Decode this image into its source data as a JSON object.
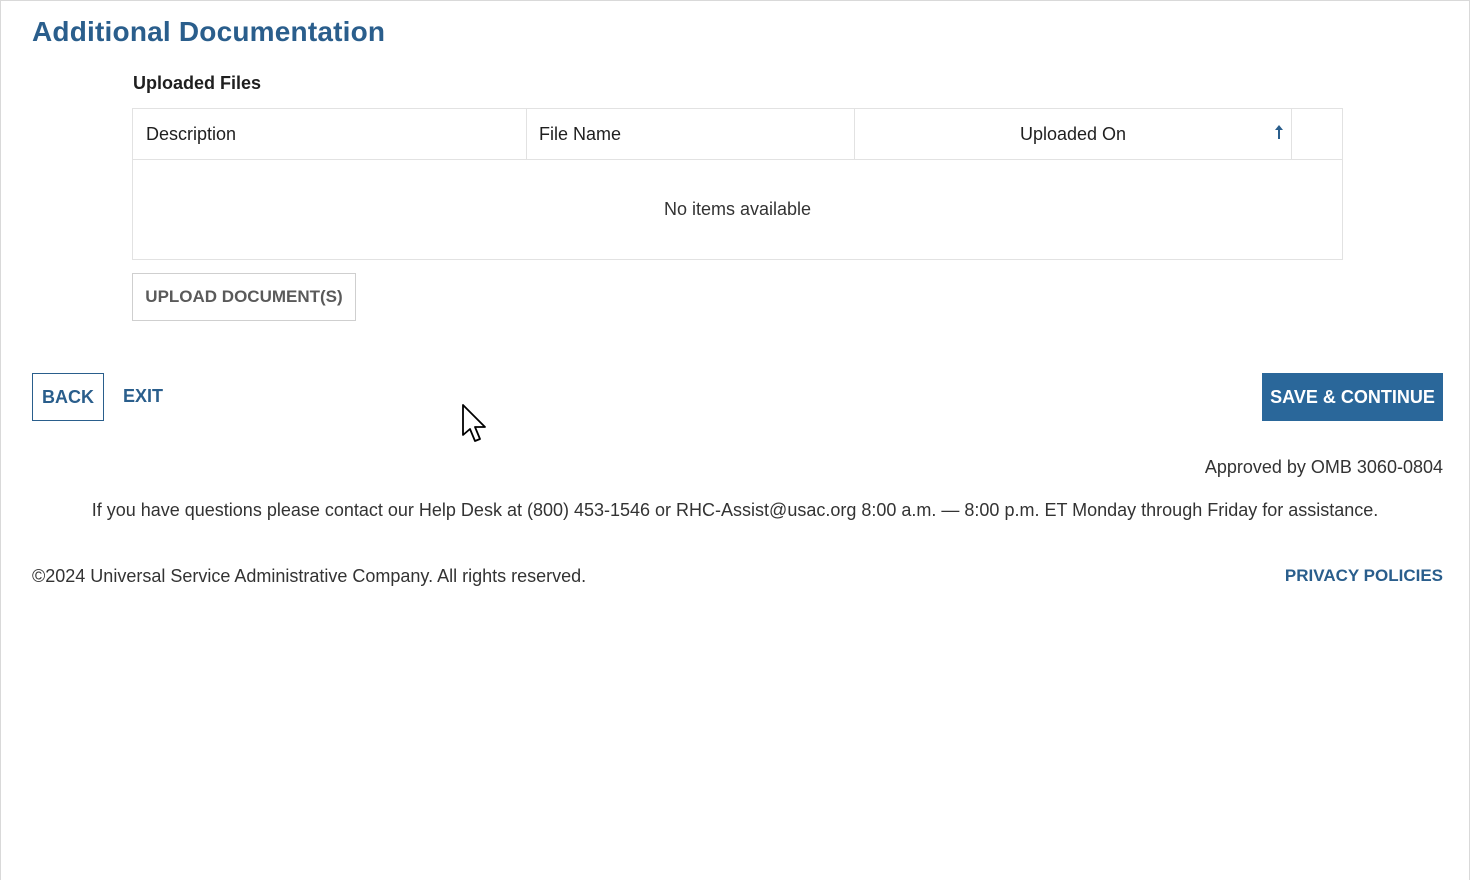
{
  "page": {
    "title": "Additional Documentation",
    "section_label": "Uploaded Files"
  },
  "table": {
    "columns": [
      "Description",
      "File Name",
      "Uploaded On",
      ""
    ],
    "sort_icon": "arrow-up-icon",
    "empty_message": "No items available"
  },
  "actions": {
    "upload_label": "UPLOAD DOCUMENT(S)",
    "back_label": "BACK",
    "exit_label": "EXIT",
    "save_label": "SAVE & CONTINUE"
  },
  "footer": {
    "omb": "Approved by OMB 3060-0804",
    "help_text": "If you have questions please contact our Help Desk at (800) 453-1546 or RHC-Assist@usac.org 8:00 a.m. — 8:00 p.m. ET Monday through Friday for assistance.",
    "copyright": "©2024 Universal Service Administrative Company. All rights reserved.",
    "privacy_label": "PRIVACY POLICIES"
  },
  "colors": {
    "accent": "#2a5e8c",
    "primary_button": "#2a679a"
  }
}
